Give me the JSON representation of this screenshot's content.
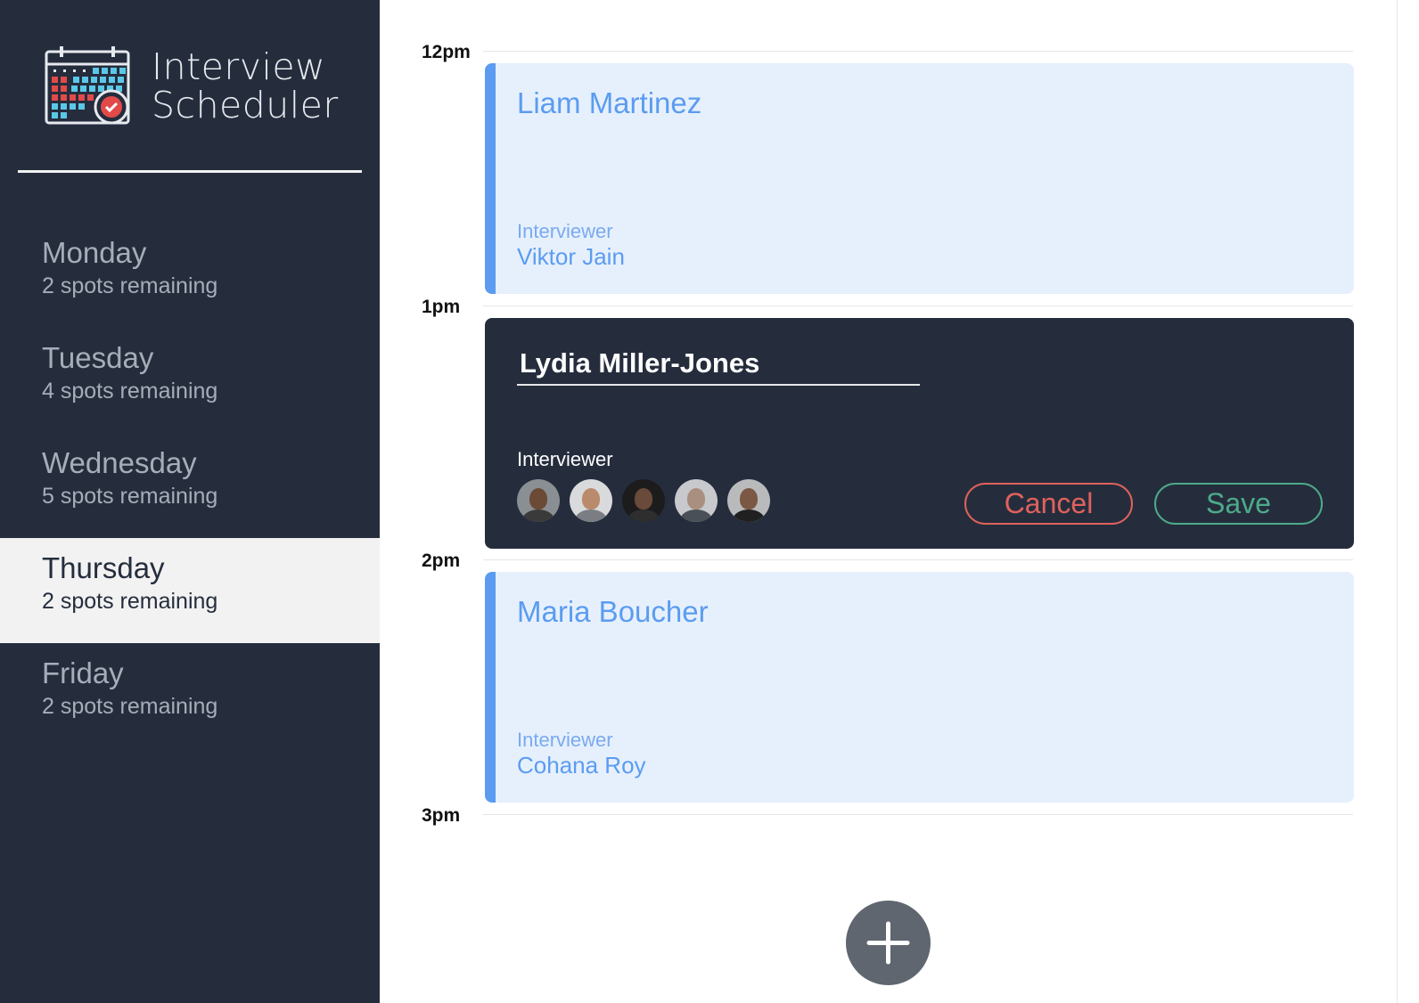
{
  "app": {
    "title_line1": "Interview",
    "title_line2": "Scheduler",
    "logo_icon": "calendar-check-icon"
  },
  "days": [
    {
      "name": "Monday",
      "spots": "2 spots remaining",
      "selected": false
    },
    {
      "name": "Tuesday",
      "spots": "4 spots remaining",
      "selected": false
    },
    {
      "name": "Wednesday",
      "spots": "5 spots remaining",
      "selected": false
    },
    {
      "name": "Thursday",
      "spots": "2 spots remaining",
      "selected": true
    },
    {
      "name": "Friday",
      "spots": "2 spots remaining",
      "selected": false
    }
  ],
  "schedule": {
    "times": [
      "12pm",
      "1pm",
      "2pm",
      "3pm"
    ],
    "appointments": [
      {
        "student": "Liam Martinez",
        "interviewer_label": "Interviewer",
        "interviewer": "Viktor Jain"
      },
      {
        "student": "Maria Boucher",
        "interviewer_label": "Interviewer",
        "interviewer": "Cohana Roy"
      }
    ],
    "editing": {
      "student": "Lydia Miller-Jones",
      "interviewer_label": "Interviewer",
      "interviewer_avatar_count": 5,
      "cancel_label": "Cancel",
      "save_label": "Save"
    }
  },
  "add_button_icon": "plus-icon",
  "colors": {
    "sidebar_bg": "#252d3d",
    "selected_day_bg": "#f2f2f2",
    "appointment_bg": "#e6f0fd",
    "appointment_accent": "#5b9cf0",
    "cancel": "#e0625c",
    "save": "#4dab8a",
    "add_button": "#5f6670"
  }
}
